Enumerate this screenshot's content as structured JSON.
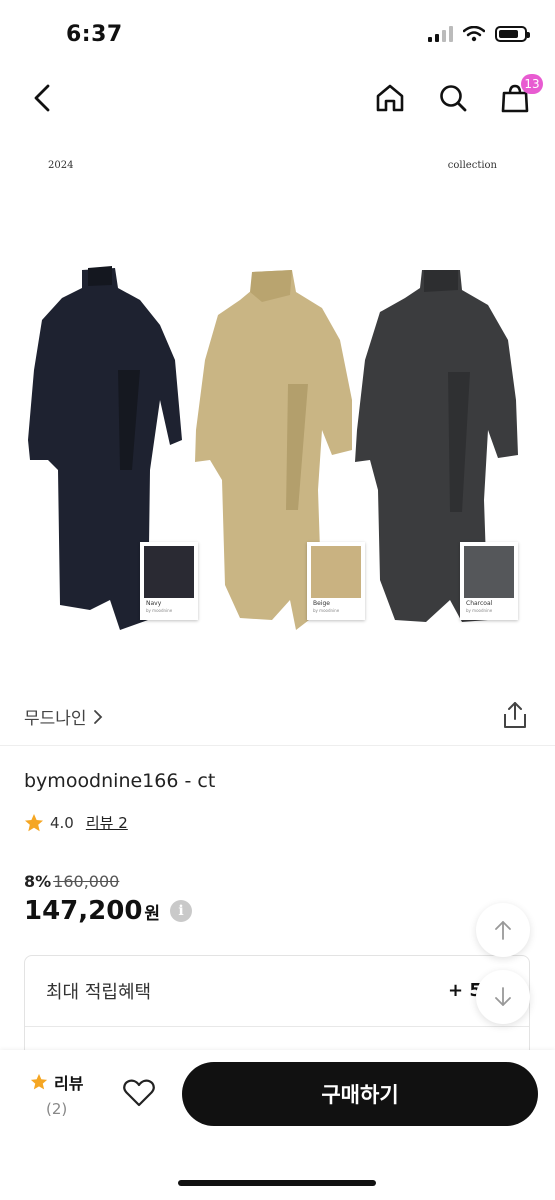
{
  "status_bar": {
    "time": "6:37"
  },
  "nav": {
    "cart_count": "13"
  },
  "product_image": {
    "year_text": "2024",
    "collection_text": "collection",
    "swatches": [
      {
        "name": "Navy",
        "brand": "by moodnine",
        "color": "#2a2a33"
      },
      {
        "name": "Beige",
        "brand": "by moodnine",
        "color": "#c9b281"
      },
      {
        "name": "Charcoal",
        "brand": "by moodnine",
        "color": "#55575a"
      }
    ],
    "coat_colors": [
      "#1e2230",
      "#c9b584",
      "#3b3c3e"
    ]
  },
  "store": {
    "name": "무드나인",
    "chevron": "›"
  },
  "product": {
    "title": "bymoodnine166 - ct",
    "rating": "4.0",
    "review_link": "리뷰 2",
    "discount": "8%",
    "original_price": "160,000",
    "price": "147,200",
    "currency": "원",
    "info_symbol": "i"
  },
  "benefit": {
    "label": "최대 적립혜택",
    "value": "+ 5"
  },
  "bottom": {
    "review_label": "리뷰",
    "review_count": "(2)",
    "buy_label": "구매하기"
  },
  "colors": {
    "star": "#f5a623",
    "badge": "#e85bd1",
    "buy_button": "#111111"
  }
}
